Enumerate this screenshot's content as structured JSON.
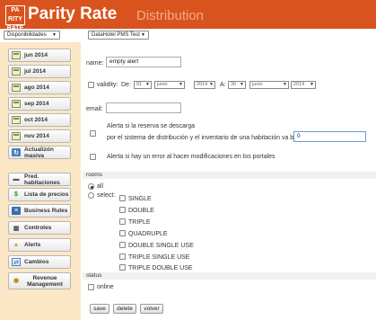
{
  "header": {
    "logo_text": "PARITY RATE",
    "title": "Parity Rate",
    "subtitle": "Distribution"
  },
  "topbar": {
    "disponibilidades": "Disponibilidades",
    "hotel": "DataHotel PMS Test"
  },
  "sidebar": {
    "items": [
      {
        "label": "jun 2014",
        "icon": "calendar-icon"
      },
      {
        "label": "jul 2014",
        "icon": "calendar-icon"
      },
      {
        "label": "ago 2014",
        "icon": "calendar-icon"
      },
      {
        "label": "sep 2014",
        "icon": "calendar-icon"
      },
      {
        "label": "oct 2014",
        "icon": "calendar-icon"
      },
      {
        "label": "nov 2014",
        "icon": "calendar-icon"
      },
      {
        "label": "Actualizón masiva",
        "icon": "refresh-icon"
      },
      {
        "label": "Pred. habitaciones",
        "icon": "bed-icon"
      },
      {
        "label": "Lista de precios",
        "icon": "dollar-icon"
      },
      {
        "label": "Business Rules",
        "icon": "rules-icon"
      },
      {
        "label": "Controles",
        "icon": "controls-icon"
      },
      {
        "label": "Alerts",
        "icon": "alert-icon"
      },
      {
        "label": "Cambios",
        "icon": "changes-icon"
      },
      {
        "label": "Revenue Management",
        "icon": "revenue-icon"
      }
    ]
  },
  "form": {
    "name_label": "name:",
    "name_value": "empty alert",
    "validity_label": "validity:",
    "de_label": "De:",
    "from_day": "01",
    "from_month": "junio",
    "from_year": "2014",
    "a_label": "A:",
    "to_day": "30",
    "to_month": "junio",
    "to_year": "2014",
    "email_label": "email:",
    "email_value": "",
    "alert1_line1": "Alerta si la reserva se descarga",
    "alert1_line2": "por el sistema de distribución y el inventario de una habitación va bajo o igual",
    "alert1_value": "0",
    "alert2_text": "Alerta si hay un error al hacer modificaciones en los portales",
    "rooms_label": "rooms",
    "all_label": "all",
    "select_label": "select:",
    "rooms": [
      "SINGLE",
      "DOUBLE",
      "TRIPLE",
      "QUADRUPLE",
      "DOUBLE SINGLE USE",
      "TRIPLE SINGLE USE",
      "TRIPLE DOUBLE USE"
    ],
    "status_label": "status",
    "online_label": "online",
    "save": "save",
    "delete": "delete",
    "volver": "volver"
  }
}
